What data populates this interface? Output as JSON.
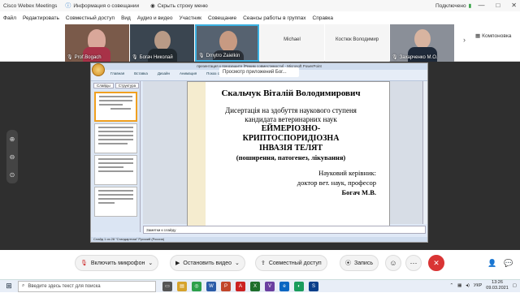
{
  "titlebar": {
    "app_title": "Cisco Webex Meetings",
    "info_label": "Информация о совещании",
    "hide_label": "Скрыть строку меню",
    "status_label": "Подключено"
  },
  "menu": [
    "Файл",
    "Редактировать",
    "Совместный доступ",
    "Вид",
    "Аудио и видео",
    "Участник",
    "Совещание",
    "Сеансы работы в группах",
    "Справка"
  ],
  "participants": [
    {
      "name": "Prof.Bogach",
      "has_video": true,
      "bg": "#7a5a4a"
    },
    {
      "name": "Богач Николай",
      "has_video": true,
      "bg": "#3a4550"
    },
    {
      "name": "Dmytro Zaielkin",
      "has_video": true,
      "bg": "#566270"
    },
    {
      "name": "Michael",
      "has_video": false,
      "bg": "#f0f0f0"
    },
    {
      "name": "Костюк Володимир",
      "has_video": false,
      "bg": "#f0f0f0"
    },
    {
      "name": "Захарченко М.О.",
      "has_video": true,
      "bg": "#8a8f98"
    }
  ],
  "panel_button_label": "Компоновка",
  "share_viewer_label": "Просмотр приложений Бог...",
  "ppt": {
    "window_title": "презентация к предзащите [Режим совместимости] - Microsoft PowerPoint",
    "ribbon_tabs": [
      "Главная",
      "Вставка",
      "Дизайн",
      "Анимация",
      "Показ слайдов",
      "Рецензирование",
      "Вид"
    ],
    "thumb_tabs": [
      "Слайды",
      "Структура"
    ],
    "notes_placeholder": "Заметки к слайду",
    "status_text": "Слайд 1 из 28   \"Стандартная\"   Русский (Россия)"
  },
  "slide": {
    "name": "Скальчук Віталій Володимирович",
    "line1": "Дисертація на здобуття наукового ступеня",
    "line2": "кандидата ветеринарних наук",
    "title1": "ЕЙМЕРІОЗНО-",
    "title2": "КРИПТОСПОРИДІОЗНА",
    "title3": "ІНВАЗІЯ ТЕЛЯТ",
    "subtitle": "(поширення, патогенез, лікування)",
    "advisor_label": "Науковий керівник:",
    "advisor_degree": "доктор вет. наук, професор",
    "advisor_name": "Богач М.В."
  },
  "controls": {
    "mic_label": "Включить микрофон",
    "video_label": "Остановить видео",
    "share_label": "Совместный доступ",
    "record_label": "Запись"
  },
  "taskbar": {
    "search_placeholder": "Введите здесь текст для поиска",
    "lang": "УКР",
    "time": "13:26",
    "date": "09.03.2021"
  },
  "colors": {
    "end_call": "#d93434",
    "stage_bg": "#2f2f2f",
    "slide_accent": "#f5eccf"
  }
}
